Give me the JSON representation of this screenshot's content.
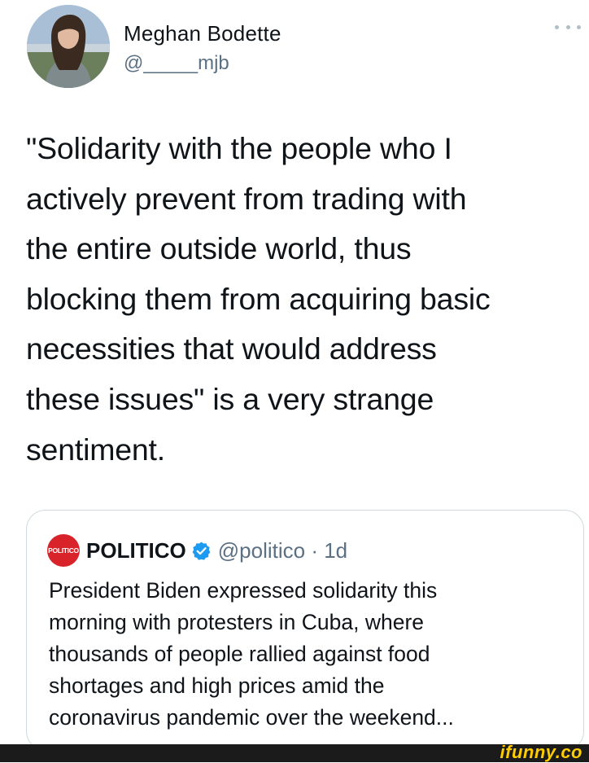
{
  "author": {
    "display_name": "Meghan Bodette",
    "handle": "@_____mjb",
    "avatar_icon": "profile-photo"
  },
  "tweet": {
    "text": "\"Solidarity with the people who I\nactively prevent from trading with\nthe entire outside world, thus\nblocking them from acquiring basic\nnecessities that would address\nthese issues\" is a very strange\nsentiment."
  },
  "more_icon": "ellipsis-icon",
  "quote": {
    "logo_text": "POLITICO",
    "name": "POLITICO",
    "verified": true,
    "handle_time": "@politico · 1d",
    "text": "President Biden expressed solidarity this\nmorning with protesters in Cuba, where\nthousands of people rallied against food\nshortages and high prices amid the\ncoronavirus pandemic over the weekend..."
  },
  "watermark": "ifunny.co",
  "colors": {
    "text": "#0f1419",
    "secondary": "#5b7083",
    "border": "#cfd9de",
    "verified": "#1d9bf0",
    "politico_red": "#d8232a",
    "watermark": "#ffcc00"
  }
}
